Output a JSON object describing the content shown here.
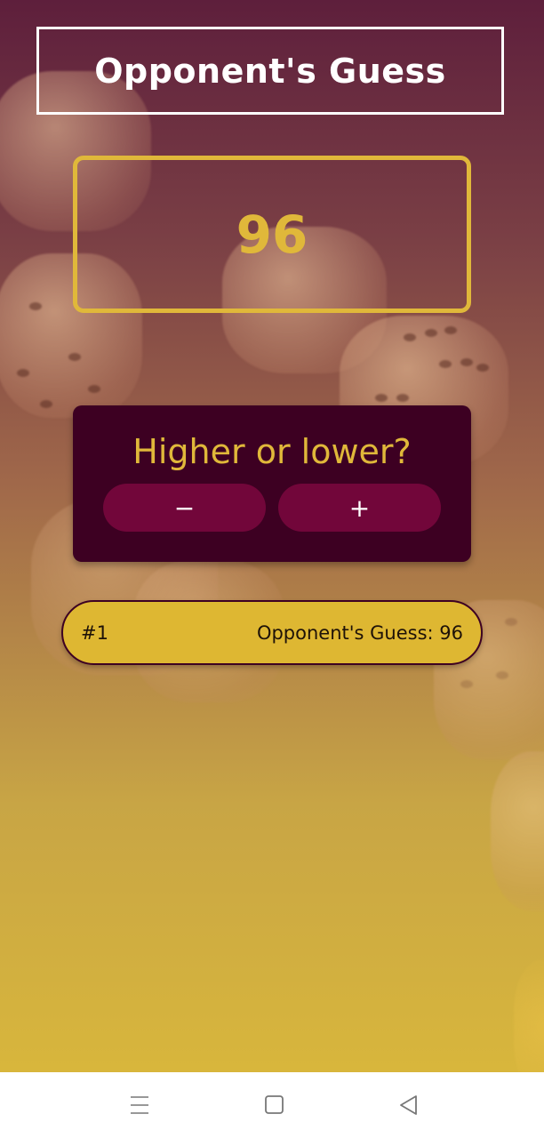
{
  "header": {
    "title": "Opponent's Guess"
  },
  "guess": {
    "value": "96"
  },
  "prompt_card": {
    "question": "Higher or lower?",
    "minus_label": "−",
    "plus_label": "+"
  },
  "guess_log": [
    {
      "round": "#1",
      "text": "Opponent's Guess: 96"
    }
  ],
  "navigation_bar": {
    "icons": [
      "menu-icon",
      "home-square-icon",
      "back-triangle-icon"
    ]
  },
  "colors": {
    "accent_gold": "#e0b83a",
    "card_dark": "#3d0022",
    "button_maroon": "#72063a",
    "background_top": "#5e1f3c",
    "background_bottom": "#d8b63c"
  }
}
